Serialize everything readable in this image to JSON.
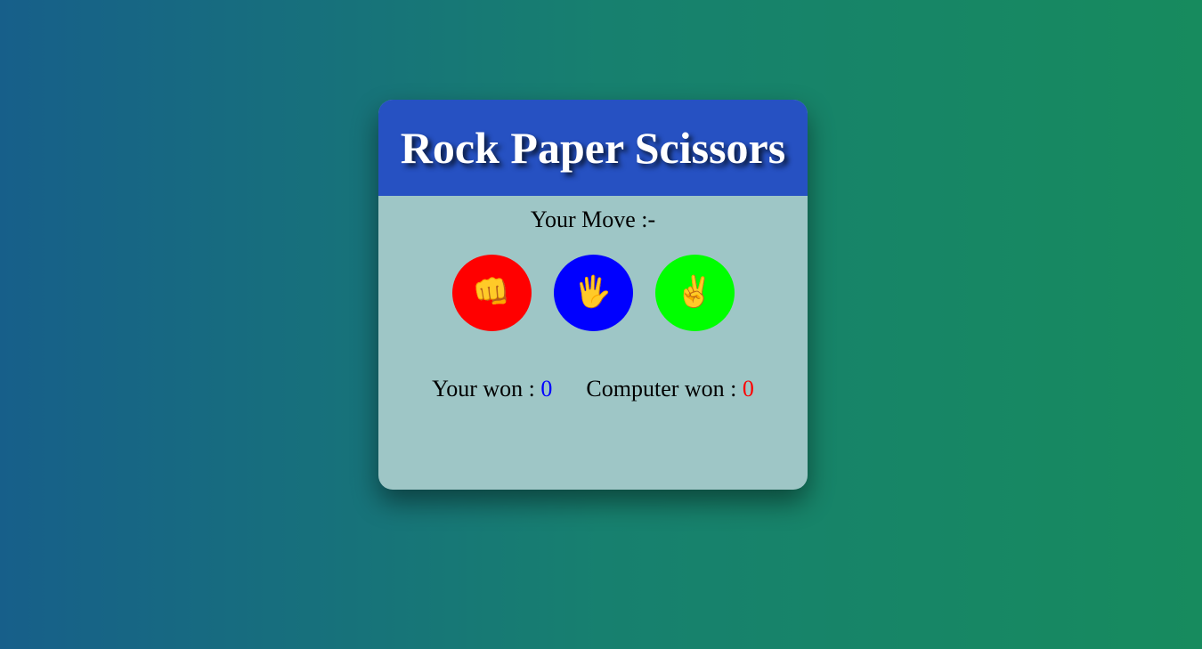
{
  "header": {
    "title": "Rock Paper Scissors"
  },
  "game": {
    "move_label": "Your Move :-",
    "choices": [
      {
        "name": "rock",
        "icon": "fist-icon",
        "glyph": "👊",
        "color": "#ff0000"
      },
      {
        "name": "paper",
        "icon": "raised-hand-icon",
        "glyph": "🖐",
        "color": "#0000ff"
      },
      {
        "name": "scissors",
        "icon": "victory-hand-icon",
        "glyph": "✌",
        "color": "#00ff00"
      }
    ]
  },
  "scores": {
    "user_label": "Your won :",
    "user_value": "0",
    "user_color": "#0000ff",
    "computer_label": "Computer won :",
    "computer_value": "0",
    "computer_color": "#ff0000"
  },
  "colors": {
    "header_bg": "#2651c2",
    "card_bg": "#9ec6c6"
  }
}
